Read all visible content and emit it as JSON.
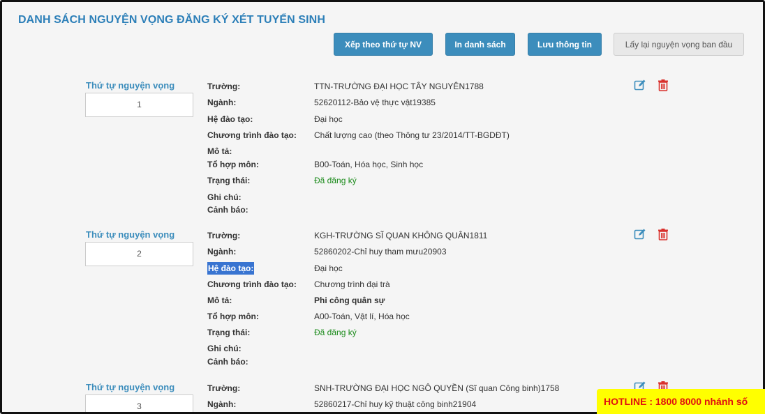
{
  "page": {
    "title": "DANH SÁCH NGUYỆN VỌNG ĐĂNG KÝ XÉT TUYỂN SINH"
  },
  "toolbar": {
    "sort_label": "Xếp theo thứ tự NV",
    "print_label": "In danh sách",
    "save_label": "Lưu thông tin",
    "reset_label": "Lấy lại nguyện vọng ban đầu"
  },
  "labels": {
    "order": "Thứ tự nguyện vọng",
    "school": "Trường:",
    "major": "Ngành:",
    "level": "Hệ đào tạo:",
    "program": "Chương trình đào tạo:",
    "description": "Mô tả:",
    "subjects": "Tổ hợp môn:",
    "status": "Trạng thái:",
    "note": "Ghi chú:",
    "warning": "Cảnh báo:"
  },
  "entries": [
    {
      "order": "1",
      "school": "TTN-TRƯỜNG ĐẠI HỌC TÂY NGUYÊN1788",
      "major": "52620112-Bảo vệ thực vật19385",
      "level": "Đại học",
      "program": "Chất lượng cao (theo Thông tư 23/2014/TT-BGDĐT)",
      "description": "",
      "subjects": "B00-Toán, Hóa học, Sinh học",
      "status": "Đã đăng ký",
      "note": "",
      "warning": ""
    },
    {
      "order": "2",
      "school": "KGH-TRƯỜNG SĨ QUAN KHÔNG QUÂN1811",
      "major": "52860202-Chỉ huy tham mưu20903",
      "level": "Đại học",
      "program": "Chương trình đại trà",
      "description": "Phi công quân sự",
      "subjects": "A00-Toán, Vật lí, Hóa học",
      "status": "Đã đăng ký",
      "note": "",
      "warning": ""
    },
    {
      "order": "3",
      "school": "SNH-TRƯỜNG ĐẠI HỌC NGÔ QUYỀN (Sĩ quan Công binh)1758",
      "major": "52860217-Chỉ huy kỹ thuật công binh21904"
    }
  ],
  "hotline": {
    "text": "HOTLINE : 1800 8000 nhánh số"
  },
  "colors": {
    "title": "#2c7fb8",
    "primary_button": "#3c8dbc",
    "edit_icon": "#3c8dbc",
    "delete_icon": "#d9302c",
    "status_text": "#1a8a1a",
    "hotline_bg": "#ffff00",
    "hotline_text": "#e01010"
  },
  "icons": {
    "edit": "edit-icon",
    "delete": "trash-icon"
  }
}
